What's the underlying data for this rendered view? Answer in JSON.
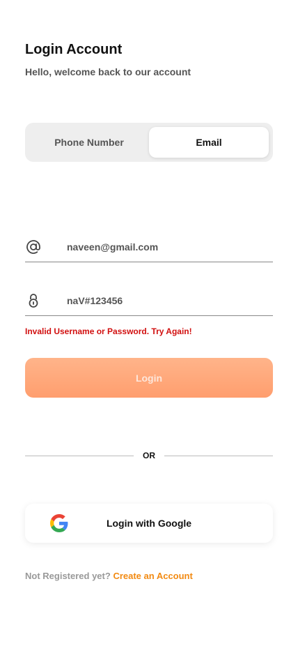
{
  "header": {
    "title": "Login Account",
    "subtitle": "Hello, welcome back to our account"
  },
  "tabs": {
    "phone_label": "Phone Number",
    "email_label": "Email",
    "selected": "Email"
  },
  "form": {
    "email_value": "naveen@gmail.com",
    "email_icon": "at-icon",
    "password_value": "naV#123456",
    "password_icon": "lock-icon",
    "error_text": "Invalid Username or Password. Try Again!",
    "login_label": "Login"
  },
  "divider": {
    "or_label": "OR"
  },
  "google": {
    "label": "Login with Google",
    "icon": "google-logo-icon"
  },
  "footer": {
    "prompt": "Not Registered yet?",
    "link_label": "Create an Account"
  },
  "colors": {
    "accent": "#ff9e6e",
    "link": "#f28a12",
    "error": "#d10f0f"
  }
}
